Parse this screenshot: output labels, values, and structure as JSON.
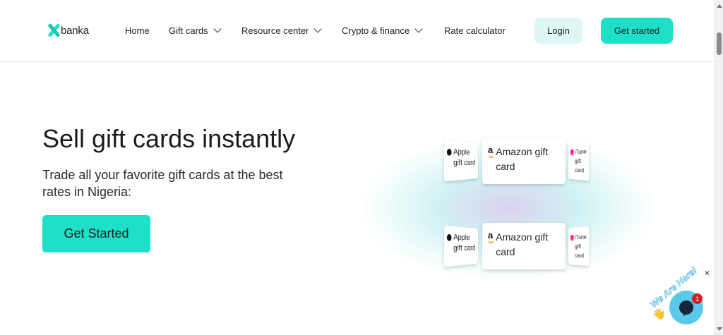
{
  "brand": {
    "logo_text": "banka",
    "accent": "#1ee0c9",
    "accent_light": "#dcf7f4"
  },
  "nav": {
    "items": [
      {
        "label": "Home",
        "has_dropdown": false
      },
      {
        "label": "Gift cards",
        "has_dropdown": true
      },
      {
        "label": "Resource center",
        "has_dropdown": true
      },
      {
        "label": "Crypto & finance",
        "has_dropdown": true
      },
      {
        "label": "Rate calculator",
        "has_dropdown": false
      }
    ],
    "login_label": "Login",
    "get_started_label": "Get started"
  },
  "hero": {
    "title": "Sell gift cards instantly",
    "subtitle": "Trade all your favorite gift cards at the best rates in Nigeria:",
    "cta_label": "Get Started"
  },
  "illustration": {
    "top_row": {
      "left": "Apple gift card",
      "center": "Amazon gift card",
      "right": "iTune gift card"
    },
    "bottom_row": {
      "left": "Apple gift card",
      "center": "Amazon gift card",
      "right": "iTune gift card"
    }
  },
  "chat_widget": {
    "close_label": "×",
    "badge_text": "We Are Here!",
    "wave_emoji": "👋",
    "notification_count": "1"
  }
}
